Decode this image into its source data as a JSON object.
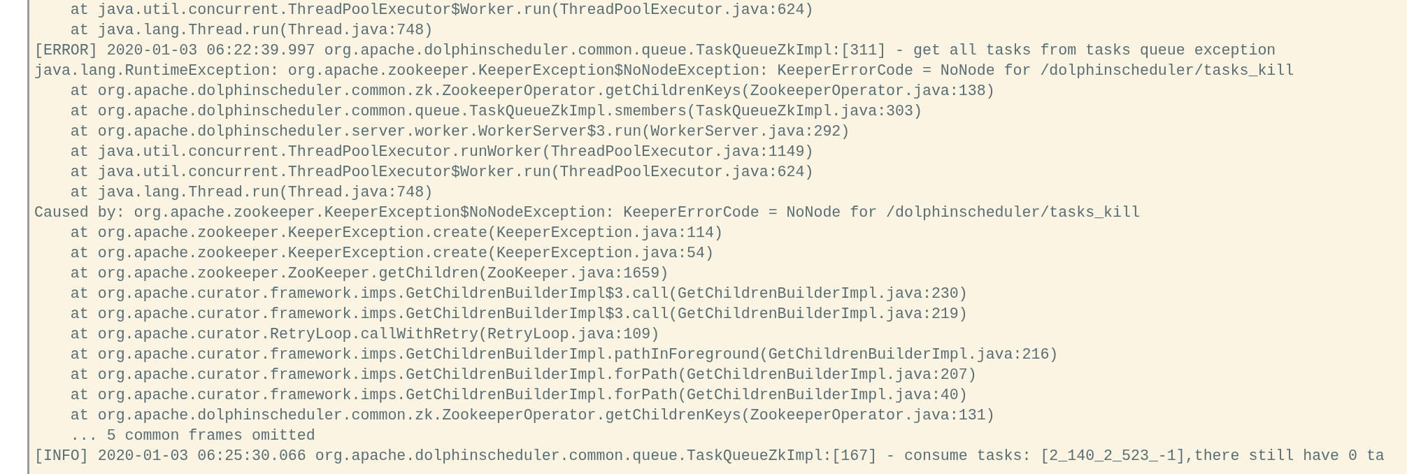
{
  "log_lines": [
    "    at java.util.concurrent.ThreadPoolExecutor$Worker.run(ThreadPoolExecutor.java:624)",
    "    at java.lang.Thread.run(Thread.java:748)",
    "[ERROR] 2020-01-03 06:22:39.997 org.apache.dolphinscheduler.common.queue.TaskQueueZkImpl:[311] - get all tasks from tasks queue exception",
    "java.lang.RuntimeException: org.apache.zookeeper.KeeperException$NoNodeException: KeeperErrorCode = NoNode for /dolphinscheduler/tasks_kill",
    "    at org.apache.dolphinscheduler.common.zk.ZookeeperOperator.getChildrenKeys(ZookeeperOperator.java:138)",
    "    at org.apache.dolphinscheduler.common.queue.TaskQueueZkImpl.smembers(TaskQueueZkImpl.java:303)",
    "    at org.apache.dolphinscheduler.server.worker.WorkerServer$3.run(WorkerServer.java:292)",
    "    at java.util.concurrent.ThreadPoolExecutor.runWorker(ThreadPoolExecutor.java:1149)",
    "    at java.util.concurrent.ThreadPoolExecutor$Worker.run(ThreadPoolExecutor.java:624)",
    "    at java.lang.Thread.run(Thread.java:748)",
    "Caused by: org.apache.zookeeper.KeeperException$NoNodeException: KeeperErrorCode = NoNode for /dolphinscheduler/tasks_kill",
    "    at org.apache.zookeeper.KeeperException.create(KeeperException.java:114)",
    "    at org.apache.zookeeper.KeeperException.create(KeeperException.java:54)",
    "    at org.apache.zookeeper.ZooKeeper.getChildren(ZooKeeper.java:1659)",
    "    at org.apache.curator.framework.imps.GetChildrenBuilderImpl$3.call(GetChildrenBuilderImpl.java:230)",
    "    at org.apache.curator.framework.imps.GetChildrenBuilderImpl$3.call(GetChildrenBuilderImpl.java:219)",
    "    at org.apache.curator.RetryLoop.callWithRetry(RetryLoop.java:109)",
    "    at org.apache.curator.framework.imps.GetChildrenBuilderImpl.pathInForeground(GetChildrenBuilderImpl.java:216)",
    "    at org.apache.curator.framework.imps.GetChildrenBuilderImpl.forPath(GetChildrenBuilderImpl.java:207)",
    "    at org.apache.curator.framework.imps.GetChildrenBuilderImpl.forPath(GetChildrenBuilderImpl.java:40)",
    "    at org.apache.dolphinscheduler.common.zk.ZookeeperOperator.getChildrenKeys(ZookeeperOperator.java:131)",
    "    ... 5 common frames omitted",
    "[INFO] 2020-01-03 06:25:30.066 org.apache.dolphinscheduler.common.queue.TaskQueueZkImpl:[167] - consume tasks: [2_140_2_523_-1],there still have 0 ta"
  ]
}
